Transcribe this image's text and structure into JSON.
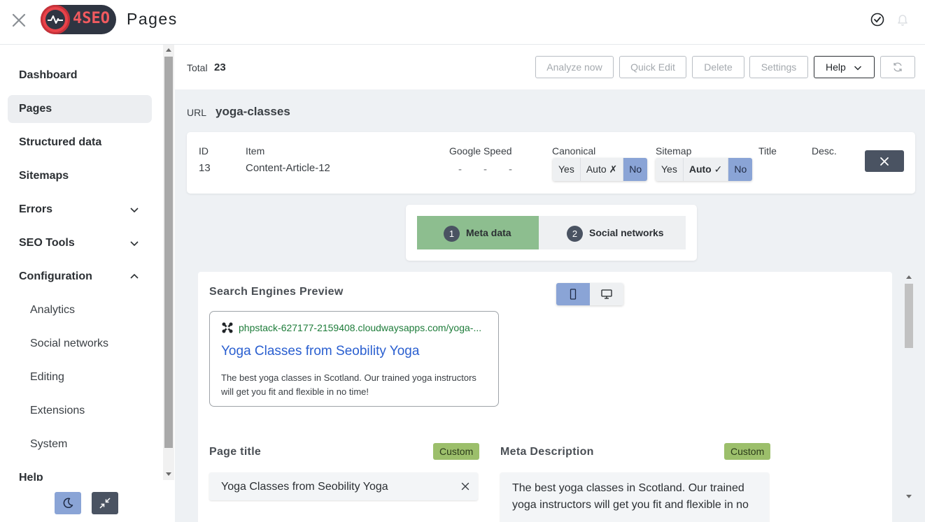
{
  "header": {
    "logo_text": "4SEO",
    "page_title": "Pages",
    "icons": [
      "close-icon",
      "check-circle-icon",
      "bell-icon"
    ]
  },
  "sidebar": {
    "items": [
      {
        "label": "Dashboard"
      },
      {
        "label": "Pages",
        "active": true
      },
      {
        "label": "Structured data"
      },
      {
        "label": "Sitemaps"
      },
      {
        "label": "Errors",
        "expandable": true
      },
      {
        "label": "SEO Tools",
        "expandable": true
      },
      {
        "label": "Configuration",
        "expanded": true
      },
      {
        "label": "Analytics",
        "sub": true
      },
      {
        "label": "Social networks",
        "sub": true
      },
      {
        "label": "Editing",
        "sub": true
      },
      {
        "label": "Extensions",
        "sub": true
      },
      {
        "label": "System",
        "sub": true
      },
      {
        "label": "Help"
      }
    ],
    "bottom_buttons": [
      "moon-icon",
      "collapse-arrows-icon"
    ]
  },
  "toolbar": {
    "total_label": "Total",
    "total_value": "23",
    "buttons": [
      "Analyze now",
      "Quick Edit",
      "Delete",
      "Settings",
      "Help"
    ],
    "refresh_icon": "refresh-icon"
  },
  "url": {
    "label": "URL",
    "value": "yoga-classes"
  },
  "row": {
    "headers": {
      "id": "ID",
      "item": "Item",
      "speed": "Google Speed",
      "canonical": "Canonical",
      "sitemap": "Sitemap",
      "title": "Title",
      "desc": "Desc."
    },
    "values": {
      "id": "13",
      "item": "Content-Article-12",
      "speed": [
        "-",
        "-",
        "-"
      ]
    },
    "canonical_options": [
      "Yes",
      "Auto ✗",
      "No"
    ],
    "canonical_selected": "No",
    "sitemap_options": [
      "Yes",
      "Auto ✓",
      "No"
    ],
    "sitemap_selected": "No"
  },
  "tabs": [
    {
      "num": "1",
      "label": "Meta data",
      "active": true
    },
    {
      "num": "2",
      "label": "Social networks"
    }
  ],
  "preview": {
    "section_title": "Search Engines Preview",
    "device_selected": "mobile",
    "url": "phpstack-627177-2159408.cloudwaysapps.com/yoga-...",
    "title": "Yoga Classes from Seobility Yoga",
    "description": "The best yoga classes in Scotland. Our trained yoga instructors will get you fit and flexible in no time!"
  },
  "fields": {
    "page_title_label": "Page title",
    "page_title_badge": "Custom",
    "page_title_value": "Yoga Classes from Seobility Yoga",
    "meta_desc_label": "Meta Description",
    "meta_desc_badge": "Custom",
    "meta_desc_value": "The best yoga classes in Scotland. Our trained yoga instructors will get you fit and flexible in no"
  },
  "colors": {
    "accent_green": "#8dbe8f",
    "accent_blue": "#8aa4d6",
    "badge_green": "#9cbf6b",
    "dark_slate": "#4a5362"
  }
}
